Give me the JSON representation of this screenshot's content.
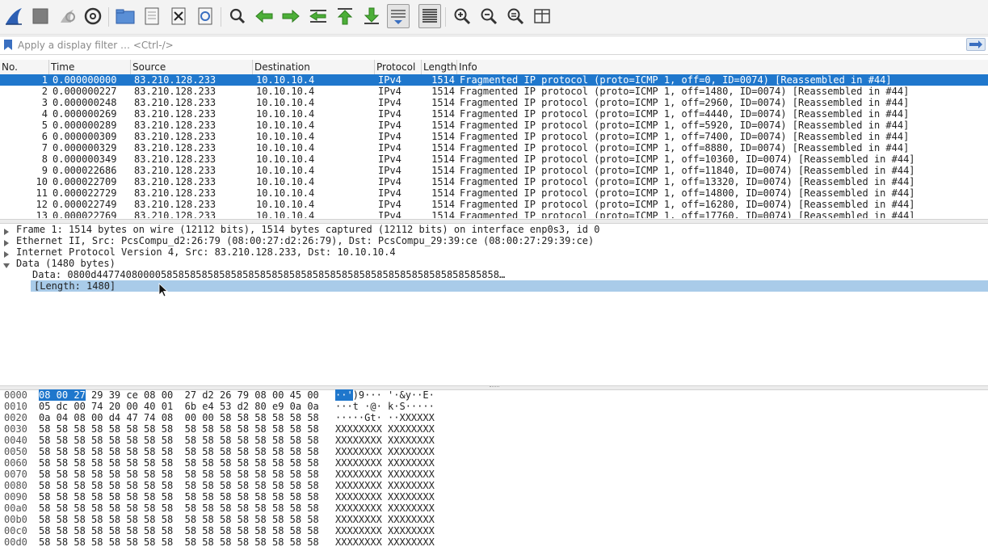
{
  "toolbar": {
    "buttons": [
      "shark-fin-icon",
      "stop-icon",
      "restart-icon",
      "options-gear-icon",
      "open-folder-icon",
      "save-file-icon",
      "close-file-icon",
      "reload-icon",
      "find-packet-icon",
      "go-back-icon",
      "go-forward-icon",
      "go-to-packet-icon",
      "go-first-icon",
      "go-last-icon",
      "autoscroll-icon",
      "colorize-icon",
      "zoom-in-icon",
      "zoom-out-icon",
      "zoom-normal-icon",
      "resize-columns-icon"
    ]
  },
  "filter": {
    "placeholder": "Apply a display filter … <Ctrl-/>"
  },
  "packet_list": {
    "columns": [
      "No.",
      "Time",
      "Source",
      "Destination",
      "Protocol",
      "Length",
      "Info"
    ],
    "rows": [
      {
        "no": "1",
        "time": "0.000000000",
        "src": "83.210.128.233",
        "dst": "10.10.10.4",
        "proto": "IPv4",
        "len": "1514",
        "info": "Fragmented IP protocol (proto=ICMP 1, off=0, ID=0074) [Reassembled in #44]"
      },
      {
        "no": "2",
        "time": "0.000000227",
        "src": "83.210.128.233",
        "dst": "10.10.10.4",
        "proto": "IPv4",
        "len": "1514",
        "info": "Fragmented IP protocol (proto=ICMP 1, off=1480, ID=0074) [Reassembled in #44]"
      },
      {
        "no": "3",
        "time": "0.000000248",
        "src": "83.210.128.233",
        "dst": "10.10.10.4",
        "proto": "IPv4",
        "len": "1514",
        "info": "Fragmented IP protocol (proto=ICMP 1, off=2960, ID=0074) [Reassembled in #44]"
      },
      {
        "no": "4",
        "time": "0.000000269",
        "src": "83.210.128.233",
        "dst": "10.10.10.4",
        "proto": "IPv4",
        "len": "1514",
        "info": "Fragmented IP protocol (proto=ICMP 1, off=4440, ID=0074) [Reassembled in #44]"
      },
      {
        "no": "5",
        "time": "0.000000289",
        "src": "83.210.128.233",
        "dst": "10.10.10.4",
        "proto": "IPv4",
        "len": "1514",
        "info": "Fragmented IP protocol (proto=ICMP 1, off=5920, ID=0074) [Reassembled in #44]"
      },
      {
        "no": "6",
        "time": "0.000000309",
        "src": "83.210.128.233",
        "dst": "10.10.10.4",
        "proto": "IPv4",
        "len": "1514",
        "info": "Fragmented IP protocol (proto=ICMP 1, off=7400, ID=0074) [Reassembled in #44]"
      },
      {
        "no": "7",
        "time": "0.000000329",
        "src": "83.210.128.233",
        "dst": "10.10.10.4",
        "proto": "IPv4",
        "len": "1514",
        "info": "Fragmented IP protocol (proto=ICMP 1, off=8880, ID=0074) [Reassembled in #44]"
      },
      {
        "no": "8",
        "time": "0.000000349",
        "src": "83.210.128.233",
        "dst": "10.10.10.4",
        "proto": "IPv4",
        "len": "1514",
        "info": "Fragmented IP protocol (proto=ICMP 1, off=10360, ID=0074) [Reassembled in #44]"
      },
      {
        "no": "9",
        "time": "0.000022686",
        "src": "83.210.128.233",
        "dst": "10.10.10.4",
        "proto": "IPv4",
        "len": "1514",
        "info": "Fragmented IP protocol (proto=ICMP 1, off=11840, ID=0074) [Reassembled in #44]"
      },
      {
        "no": "10",
        "time": "0.000022709",
        "src": "83.210.128.233",
        "dst": "10.10.10.4",
        "proto": "IPv4",
        "len": "1514",
        "info": "Fragmented IP protocol (proto=ICMP 1, off=13320, ID=0074) [Reassembled in #44]"
      },
      {
        "no": "11",
        "time": "0.000022729",
        "src": "83.210.128.233",
        "dst": "10.10.10.4",
        "proto": "IPv4",
        "len": "1514",
        "info": "Fragmented IP protocol (proto=ICMP 1, off=14800, ID=0074) [Reassembled in #44]"
      },
      {
        "no": "12",
        "time": "0.000022749",
        "src": "83.210.128.233",
        "dst": "10.10.10.4",
        "proto": "IPv4",
        "len": "1514",
        "info": "Fragmented IP protocol (proto=ICMP 1, off=16280, ID=0074) [Reassembled in #44]"
      },
      {
        "no": "13",
        "time": "0.000022769",
        "src": "83.210.128.233",
        "dst": "10.10.10.4",
        "proto": "IPv4",
        "len": "1514",
        "info": "Fragmented IP protocol (proto=ICMP 1, off=17760, ID=0074) [Reassembled in #44]"
      }
    ]
  },
  "details": {
    "rows": [
      {
        "text": "Frame 1: 1514 bytes on wire (12112 bits), 1514 bytes captured (12112 bits) on interface enp0s3, id 0",
        "expander": "collapsed"
      },
      {
        "text": "Ethernet II, Src: PcsCompu_d2:26:79 (08:00:27:d2:26:79), Dst: PcsCompu_29:39:ce (08:00:27:29:39:ce)",
        "expander": "collapsed"
      },
      {
        "text": "Internet Protocol Version 4, Src: 83.210.128.233, Dst: 10.10.10.4",
        "expander": "collapsed"
      },
      {
        "text": "Data (1480 bytes)",
        "expander": "expanded"
      },
      {
        "text": "Data: 0800d447740800005858585858585858585858585858585858585858585858585858585858…",
        "expander": "none"
      },
      {
        "text": "[Length: 1480]",
        "expander": "none",
        "selected": true
      }
    ]
  },
  "hex": {
    "rows": [
      {
        "off": "0000",
        "bytes": "08 00 27 29 39 ce 08 00  27 d2 26 79 08 00 45 00",
        "ascii": "··')9··· '·&y··E·"
      },
      {
        "off": "0010",
        "bytes": "05 dc 00 74 20 00 40 01  6b e4 53 d2 80 e9 0a 0a",
        "ascii": "···t ·@· k·S·····"
      },
      {
        "off": "0020",
        "bytes": "0a 04 08 00 d4 47 74 08  00 00 58 58 58 58 58 58",
        "ascii": "·····Gt· ··XXXXXX"
      },
      {
        "off": "0030",
        "bytes": "58 58 58 58 58 58 58 58  58 58 58 58 58 58 58 58",
        "ascii": "XXXXXXXX XXXXXXXX"
      },
      {
        "off": "0040",
        "bytes": "58 58 58 58 58 58 58 58  58 58 58 58 58 58 58 58",
        "ascii": "XXXXXXXX XXXXXXXX"
      },
      {
        "off": "0050",
        "bytes": "58 58 58 58 58 58 58 58  58 58 58 58 58 58 58 58",
        "ascii": "XXXXXXXX XXXXXXXX"
      },
      {
        "off": "0060",
        "bytes": "58 58 58 58 58 58 58 58  58 58 58 58 58 58 58 58",
        "ascii": "XXXXXXXX XXXXXXXX"
      },
      {
        "off": "0070",
        "bytes": "58 58 58 58 58 58 58 58  58 58 58 58 58 58 58 58",
        "ascii": "XXXXXXXX XXXXXXXX"
      },
      {
        "off": "0080",
        "bytes": "58 58 58 58 58 58 58 58  58 58 58 58 58 58 58 58",
        "ascii": "XXXXXXXX XXXXXXXX"
      },
      {
        "off": "0090",
        "bytes": "58 58 58 58 58 58 58 58  58 58 58 58 58 58 58 58",
        "ascii": "XXXXXXXX XXXXXXXX"
      },
      {
        "off": "00a0",
        "bytes": "58 58 58 58 58 58 58 58  58 58 58 58 58 58 58 58",
        "ascii": "XXXXXXXX XXXXXXXX"
      },
      {
        "off": "00b0",
        "bytes": "58 58 58 58 58 58 58 58  58 58 58 58 58 58 58 58",
        "ascii": "XXXXXXXX XXXXXXXX"
      },
      {
        "off": "00c0",
        "bytes": "58 58 58 58 58 58 58 58  58 58 58 58 58 58 58 58",
        "ascii": "XXXXXXXX XXXXXXXX"
      },
      {
        "off": "00d0",
        "bytes": "58 58 58 58 58 58 58 58  58 58 58 58 58 58 58 58",
        "ascii": "XXXXXXXX XXXXXXXX"
      }
    ],
    "selection": {
      "row": 0,
      "bytes_selected": "08 00 27",
      "ascii_selected": "··'"
    }
  },
  "colors": {
    "selection": "#1f77cc",
    "detail_highlight": "#a9cbe9",
    "accent_blue": "#3a6fc0",
    "green": "#4caf38"
  }
}
